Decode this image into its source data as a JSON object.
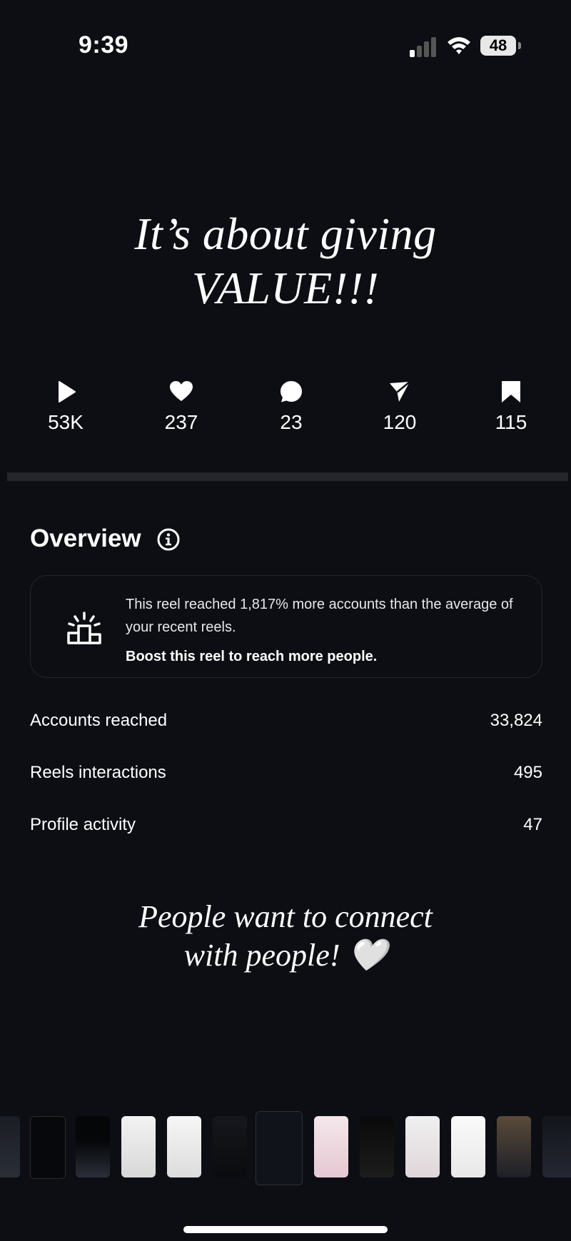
{
  "status_bar": {
    "time": "9:39",
    "battery_percent": "48",
    "signal_bars_active": 1,
    "signal_bars_total": 4,
    "icons": [
      "signal-icon",
      "wifi-icon",
      "battery-icon"
    ]
  },
  "headline": {
    "line1": "It’s about giving",
    "line2": "VALUE!!!"
  },
  "stats": [
    {
      "icon": "play-icon",
      "value": "53K"
    },
    {
      "icon": "heart-icon",
      "value": "237"
    },
    {
      "icon": "comment-icon",
      "value": "23"
    },
    {
      "icon": "share-icon",
      "value": "120"
    },
    {
      "icon": "bookmark-icon",
      "value": "115"
    }
  ],
  "overview": {
    "title": "Overview",
    "info_icon": "info-icon",
    "card": {
      "icon": "podium-icon",
      "text": "This reel reached 1,817% more accounts than the average of your recent reels.",
      "cta": "Boost this reel to reach more people."
    },
    "metrics": [
      {
        "label": "Accounts reached",
        "value": "33,824"
      },
      {
        "label": "Reels interactions",
        "value": "495"
      },
      {
        "label": "Profile activity",
        "value": "47"
      }
    ]
  },
  "tagline": {
    "line1": "People want to connect",
    "line2": "with people! 🤍"
  },
  "thumbnail_strip": {
    "count": 13,
    "selected_index": 6
  },
  "colors": {
    "background": "#0c0e14",
    "divider": "#24262b",
    "card_border": "#22252c",
    "text": "#ffffff"
  }
}
